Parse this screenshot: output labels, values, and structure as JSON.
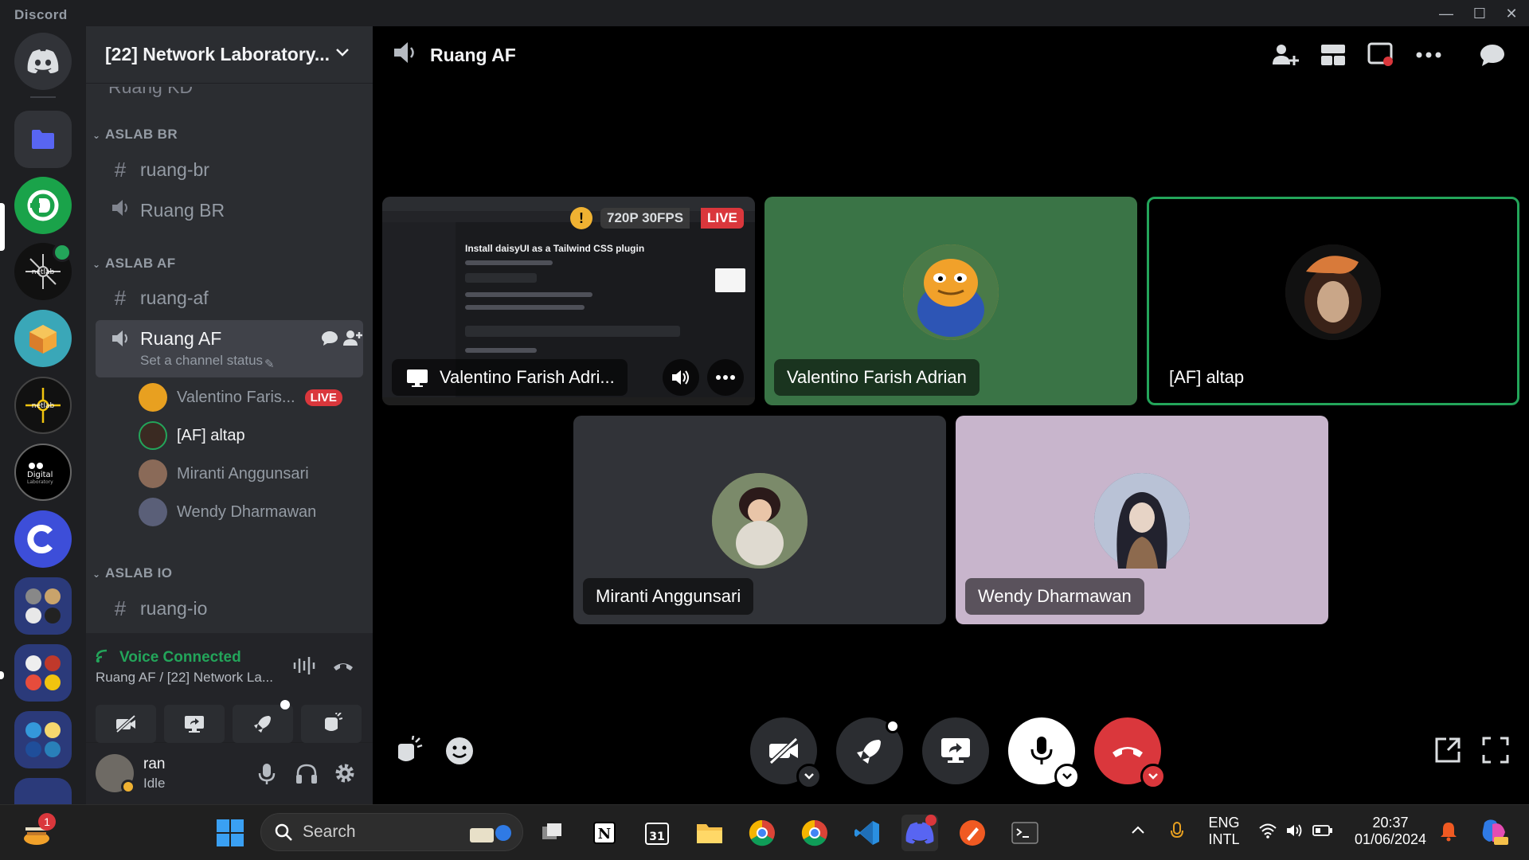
{
  "app": {
    "title": "Discord"
  },
  "server": {
    "name": "[22] Network Laboratory..."
  },
  "sidebar": {
    "partial_channel": "Ruang KD",
    "categories": [
      {
        "label": "ASLAB BR"
      },
      {
        "label": "ASLAB AF"
      },
      {
        "label": "ASLAB IO"
      }
    ],
    "channels": {
      "ruang_br_text": "ruang-br",
      "ruang_br_voice": "Ruang BR",
      "ruang_af_text": "ruang-af",
      "ruang_af_voice": "Ruang AF",
      "ruang_af_status": "Set a channel status",
      "ruang_io_text": "ruang-io"
    },
    "members": [
      {
        "name": "Valentino Faris...",
        "live": "LIVE"
      },
      {
        "name": "[AF] altap"
      },
      {
        "name": "Miranti Anggunsari"
      },
      {
        "name": "Wendy Dharmawan"
      }
    ]
  },
  "voice": {
    "status": "Voice Connected",
    "location": "Ruang AF / [22] Network La..."
  },
  "user": {
    "name": "ran",
    "status": "Idle"
  },
  "main": {
    "channel_title": "Ruang AF",
    "stream": {
      "quality": "720P 30FPS",
      "live": "LIVE",
      "name": "Valentino Farish Adri...",
      "preview_title": "Install daisyUI as a Tailwind CSS plugin"
    },
    "tiles": [
      {
        "name": "Valentino Farish Adrian"
      },
      {
        "name": "[AF] altap"
      },
      {
        "name": "Miranti Anggunsari"
      },
      {
        "name": "Wendy Dharmawan"
      }
    ]
  },
  "taskbar": {
    "search_placeholder": "Search",
    "notification_count": "1",
    "lang_top": "ENG",
    "lang_bottom": "INTL",
    "time": "20:37",
    "date": "01/06/2024"
  },
  "colors": {
    "green_tile": "#3a7446",
    "lavender_tile": "#c8b5cc",
    "dark_tile": "#313338",
    "speaking_border": "#23a55a",
    "live_red": "#da373c",
    "hangup_red": "#da373c"
  }
}
